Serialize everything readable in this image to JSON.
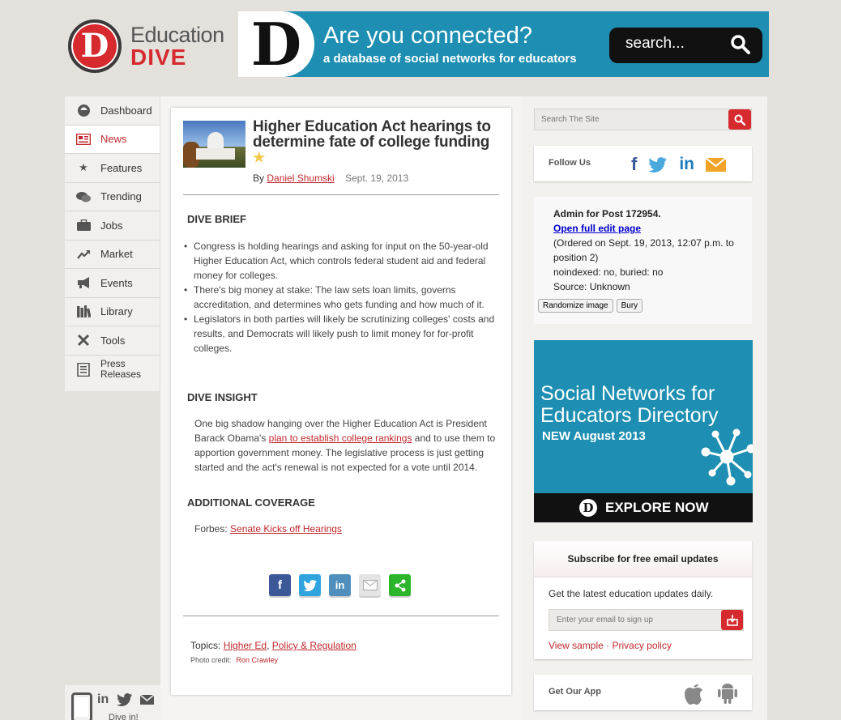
{
  "header": {
    "logo_letter": "D",
    "logo_word1": "Education",
    "logo_word2": "DIVE",
    "banner": {
      "letter": "D",
      "headline": "Are you connected?",
      "subline": "a database of social networks for educators",
      "search_label": "search..."
    }
  },
  "nav": {
    "items": [
      {
        "label": "Dashboard",
        "icon": "dashboard-icon"
      },
      {
        "label": "News",
        "icon": "news-icon",
        "active": true
      },
      {
        "label": "Features",
        "icon": "star-icon"
      },
      {
        "label": "Trending",
        "icon": "chat-bubbles-icon"
      },
      {
        "label": "Jobs",
        "icon": "briefcase-icon"
      },
      {
        "label": "Market",
        "icon": "trend-arrow-icon"
      },
      {
        "label": "Events",
        "icon": "megaphone-icon"
      },
      {
        "label": "Library",
        "icon": "books-icon"
      },
      {
        "label": "Tools",
        "icon": "tools-icon"
      },
      {
        "label_line1": "Press",
        "label_line2": "Releases",
        "icon": "press-icon"
      }
    ],
    "bottom_label": "Dive in!"
  },
  "article": {
    "title": "Higher Education Act hearings to determine fate of college funding",
    "by": "By",
    "author": "Daniel Shumski",
    "date": "Sept. 19, 2013",
    "brief_heading": "DIVE BRIEF",
    "brief": [
      "Congress is holding hearings and asking for input on the 50-year-old Higher Education Act, which controls federal student aid and federal money for colleges.",
      "There's big money at stake: The law sets loan limits, governs accreditation, and determines who gets funding and how much of it.",
      "Legislators in both parties will likely be scrutinizing colleges' costs and results, and Democrats will likely push to limit money for for-profit colleges."
    ],
    "insight_heading": "DIVE INSIGHT",
    "insight_pre": "One big shadow hanging over the Higher Education Act is President Barack Obama's ",
    "insight_link": "plan to establish college rankings",
    "insight_post": " and to use them to apportion government money. The legislative process is just getting started and the act's renewal is not expected for a vote until 2014.",
    "coverage_heading": "ADDITIONAL COVERAGE",
    "coverage_source": "Forbes: ",
    "coverage_link": "Senate Kicks off Hearings",
    "topics_label": "Topics: ",
    "topic1": "Higher Ed",
    "topic_sep": ", ",
    "topic2": "Policy & Regulation",
    "credit_label": "Photo credit:",
    "credit_name": "Ron Crawley"
  },
  "sidebar": {
    "search_placeholder": "Search The Site",
    "follow_label": "Follow Us",
    "admin": {
      "line1": "Admin for Post 172954.",
      "edit_link": "Open full edit page",
      "line3": "(Ordered on Sept. 19, 2013, 12:07 p.m. to position 2)",
      "line4": "noindexed: no, buried: no",
      "line5": "Source: Unknown",
      "btn_randomize": "Randomize image",
      "btn_bury": "Bury"
    },
    "ad": {
      "line1": "Social Networks for",
      "line2": "Educators Directory",
      "line3": "NEW August 2013",
      "cta": "EXPLORE NOW",
      "cta_letter": "D"
    },
    "subscribe": {
      "heading": "Subscribe for free email updates",
      "text": "Get the latest education updates daily.",
      "placeholder": "Enter your email to sign up",
      "view_sample": "View sample",
      "separator": " · ",
      "privacy": "Privacy policy"
    },
    "app_label": "Get Our App"
  },
  "colors": {
    "brand_red": "#d62a2f",
    "banner_blue": "#1e8fb2",
    "link_red": "#c0282d"
  }
}
